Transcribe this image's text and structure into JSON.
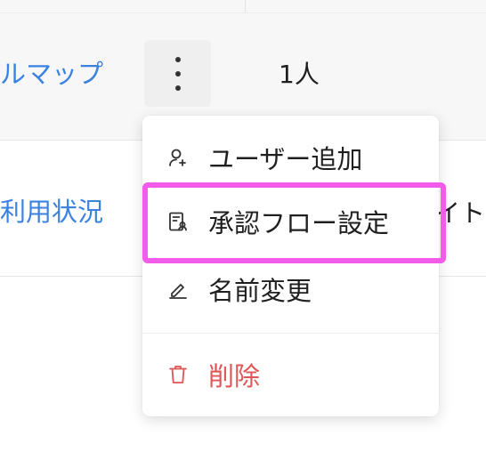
{
  "table": {
    "rows": [
      {
        "name": "ルマップ",
        "count": "1人"
      },
      {
        "name": "利用状況",
        "peek": "イト"
      }
    ]
  },
  "menu": {
    "items": [
      {
        "label": "ユーザー追加",
        "icon": "user-add-icon"
      },
      {
        "label": "承認フロー設定",
        "icon": "approval-flow-icon"
      },
      {
        "label": "名前変更",
        "icon": "pencil-icon"
      },
      {
        "label": "削除",
        "icon": "trash-icon",
        "color": "#e05555"
      }
    ]
  },
  "colors": {
    "link": "#3b82e0",
    "highlight": "#f25ce8",
    "danger": "#e05555"
  }
}
